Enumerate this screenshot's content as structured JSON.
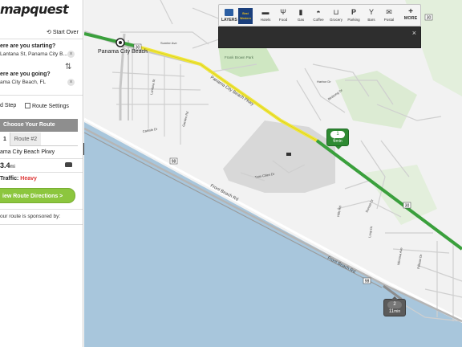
{
  "sidebar": {
    "logo": "mapquest",
    "start_over": "Start Over",
    "start_question": "ere are you starting?",
    "start_value": "Lantana St, Panama City B...",
    "end_question": "ere are you going?",
    "end_value": "ama City Beach, FL",
    "add_stop": "d Step",
    "route_settings": "Route Settings",
    "choose_route": "Choose Your Route",
    "tabs": [
      "1",
      "Route #2"
    ],
    "route_name": "ama City Beach Pkwy",
    "distance_value": "3.4",
    "distance_unit": "mi",
    "traffic_label": "Traffic:",
    "traffic_level": "Heavy",
    "directions_button": "iew Route Directions >",
    "sponsor_text": "our route is sponsored by:"
  },
  "toolbar": {
    "layers": "LAYERS",
    "brand": "Best Western",
    "items": [
      {
        "label": "Hotels",
        "icon": "bed-icon"
      },
      {
        "label": "Food",
        "icon": "fork-knife-icon"
      },
      {
        "label": "Gas",
        "icon": "gas-pump-icon"
      },
      {
        "label": "Coffee",
        "icon": "coffee-cup-icon"
      },
      {
        "label": "Grocery",
        "icon": "cart-icon"
      },
      {
        "label": "Parking",
        "icon": "parking-icon"
      },
      {
        "label": "Bars",
        "icon": "cocktail-icon"
      },
      {
        "label": "Postal",
        "icon": "mail-icon"
      }
    ],
    "more": "MORE",
    "close_glyph": "×"
  },
  "map": {
    "place_panama": "Panama City Beach",
    "place_frank": "Frank Brown Park",
    "roads": {
      "parkway": "Panama City Beach Pkwy",
      "front_beach": "Front Beach Rd",
      "front_beach_2": "Front Beach Rd",
      "hills": "Hills Rd",
      "twin_cities": "Twin Cities Dr",
      "sumter": "Sumter Ave",
      "carlisle": "Carlisle Dr",
      "garden": "Garden Rd",
      "lantana": "Lantana St",
      "harbor": "Harbor Dr",
      "sunset": "Sunset Dr",
      "mimosa": "Mimosa Ave",
      "birdsong": "Birdsong Dr",
      "pelican": "Pelican Dr",
      "loop": "Loop Dr"
    },
    "shields": [
      "98",
      "30",
      "98",
      "30",
      "30"
    ],
    "route1": {
      "number": "1",
      "time_value": "6",
      "time_unit": "min"
    },
    "route2": {
      "number": "2",
      "time_value": "11",
      "time_unit": "min"
    },
    "colors": {
      "land": "#f2f2f2",
      "water": "#a8c6dc",
      "park": "#cfe7c2",
      "campus": "#d8d8d8",
      "route_primary": "#3aa03c",
      "route_slow": "#f1e83a",
      "route_alt": "#8c8c8c"
    }
  }
}
